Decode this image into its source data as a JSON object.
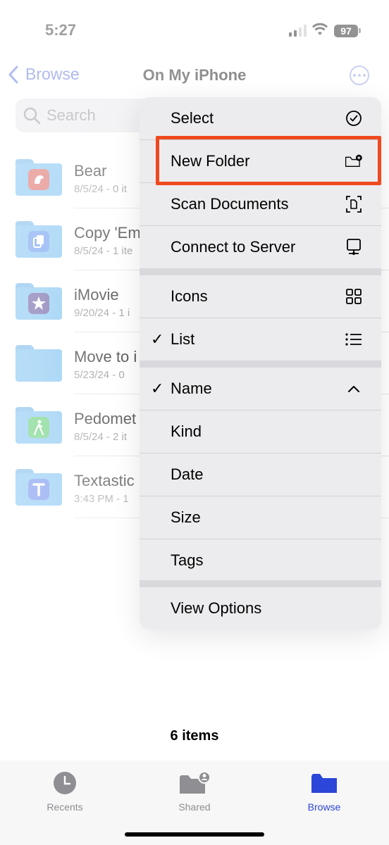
{
  "status_bar": {
    "time": "5:27",
    "battery": "97"
  },
  "nav": {
    "back_label": "Browse",
    "title": "On My iPhone",
    "more_icon": "ellipsis-circle-icon"
  },
  "search": {
    "placeholder": "Search"
  },
  "files": [
    {
      "name": "Bear",
      "meta": "8/5/24 - 0 it",
      "app_icon": "bear-app-icon",
      "app_color": "#d13a35"
    },
    {
      "name": "Copy 'Em",
      "meta": "8/5/24 - 1 ite",
      "app_icon": "copy-em-app-icon",
      "app_color": "#3c7bea"
    },
    {
      "name": "iMovie",
      "meta": "9/20/24 - 1 i",
      "app_icon": "imovie-app-icon",
      "app_color": "#3b2a86"
    },
    {
      "name": "Move to i",
      "meta": "5/23/24 - 0",
      "app_icon": "",
      "app_color": ""
    },
    {
      "name": "Pedomet",
      "meta": "8/5/24 - 2 it",
      "app_icon": "pedometer-app-icon",
      "app_color": "#2fbf4a"
    },
    {
      "name": "Textastic",
      "meta": "3:43 PM - 1",
      "app_icon": "textastic-app-icon",
      "app_color": "#3d67e6"
    }
  ],
  "menu": {
    "select": "Select",
    "new_folder": "New Folder",
    "scan_documents": "Scan Documents",
    "connect_to_server": "Connect to Server",
    "icons": "Icons",
    "list": "List",
    "name": "Name",
    "kind": "Kind",
    "date": "Date",
    "size": "Size",
    "tags": "Tags",
    "view_options": "View Options",
    "checkmark": "✓"
  },
  "footer": {
    "items_count": "6 items"
  },
  "tab_bar": {
    "recents": "Recents",
    "shared": "Shared",
    "browse": "Browse"
  },
  "colors": {
    "accent": "#2f4fd6",
    "highlight": "#ef4a1f"
  }
}
